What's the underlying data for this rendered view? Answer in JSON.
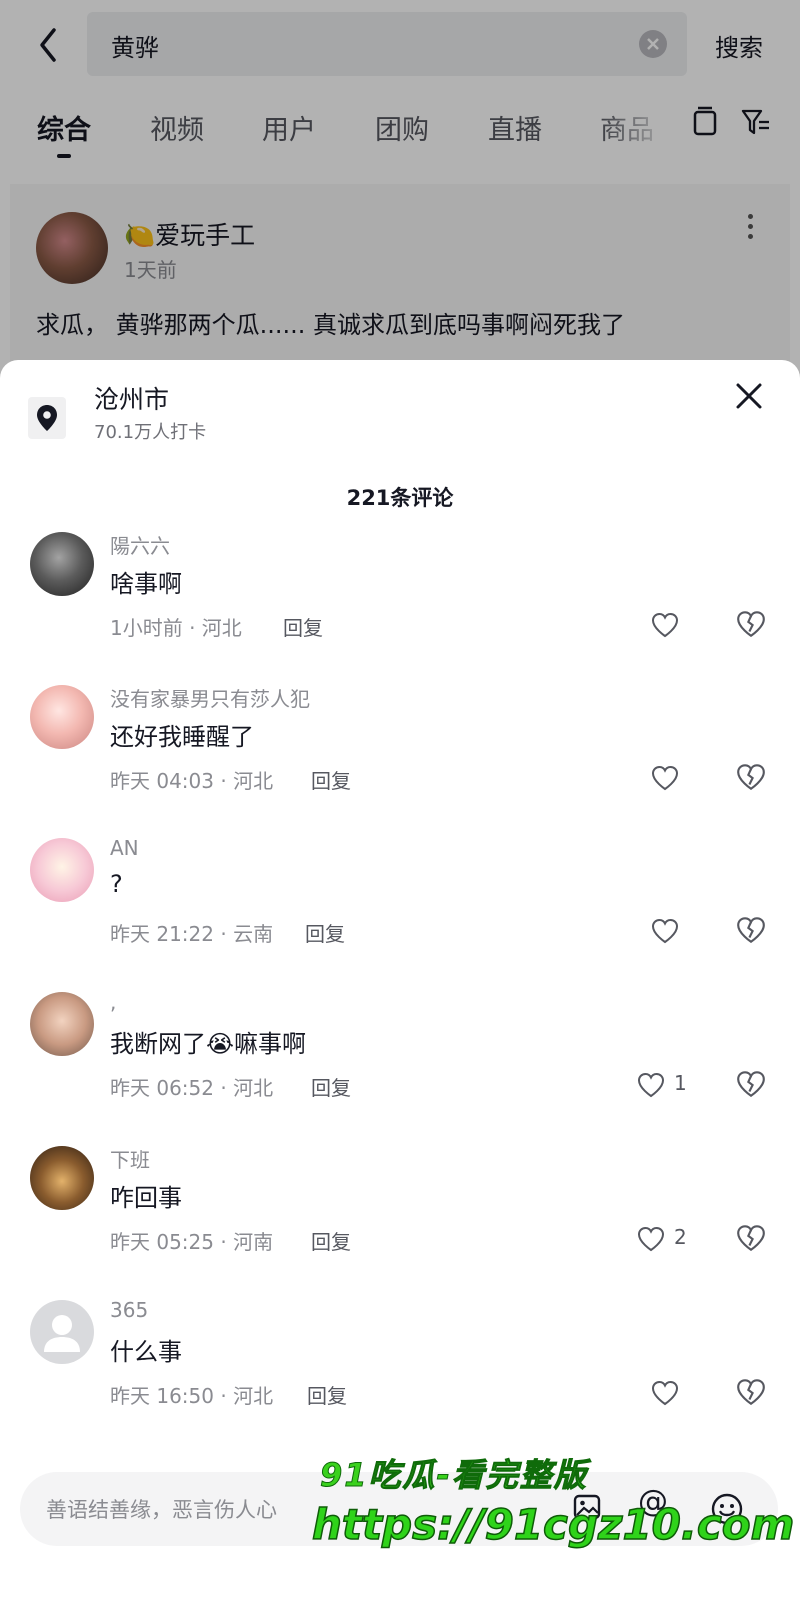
{
  "search": {
    "query": "黄骅",
    "submit_label": "搜索"
  },
  "tabs": [
    {
      "label": "综合",
      "active": true
    },
    {
      "label": "视频"
    },
    {
      "label": "用户"
    },
    {
      "label": "团购"
    },
    {
      "label": "直播"
    },
    {
      "label": "商品"
    }
  ],
  "feed": {
    "author": "🍋爱玩手工",
    "time": "1天前",
    "text": "求瓜， 黄骅那两个瓜...... 真诚求瓜到底吗事啊闷死我了"
  },
  "sheet": {
    "location_title": "沧州市",
    "location_sub": "70.1万人打卡",
    "comment_count": "221条评论"
  },
  "comments": [
    {
      "name": "陽六六",
      "text": "啥事啊",
      "meta": "1小时前 · 河北",
      "reply": "回复",
      "likes": ""
    },
    {
      "name": "没有家暴男只有莎人犯",
      "text": "还好我睡醒了",
      "meta": "昨天 04:03 · 河北",
      "reply": "回复",
      "likes": ""
    },
    {
      "name": "AN",
      "text": "?",
      "meta": "昨天 21:22 · 云南",
      "reply": "回复",
      "likes": ""
    },
    {
      "name": ",",
      "text": "我断网了😭嘛事啊",
      "meta": "昨天 06:52 · 河北",
      "reply": "回复",
      "likes": "1"
    },
    {
      "name": "下班",
      "text": "咋回事",
      "meta": "昨天 05:25 · 河南",
      "reply": "回复",
      "likes": "2"
    },
    {
      "name": "365",
      "text": "什么事",
      "meta": "昨天 16:50 · 河北",
      "reply": "回复",
      "likes": ""
    }
  ],
  "input": {
    "placeholder": "善语结善缘，恶言伤人心"
  },
  "watermark": {
    "line1": "91吃瓜-看完整版",
    "line2": "https://91cgz10.com"
  },
  "colors": {
    "text_primary": "#161823",
    "text_secondary": "#8a8b91",
    "watermark_green": "#2fd31a"
  }
}
